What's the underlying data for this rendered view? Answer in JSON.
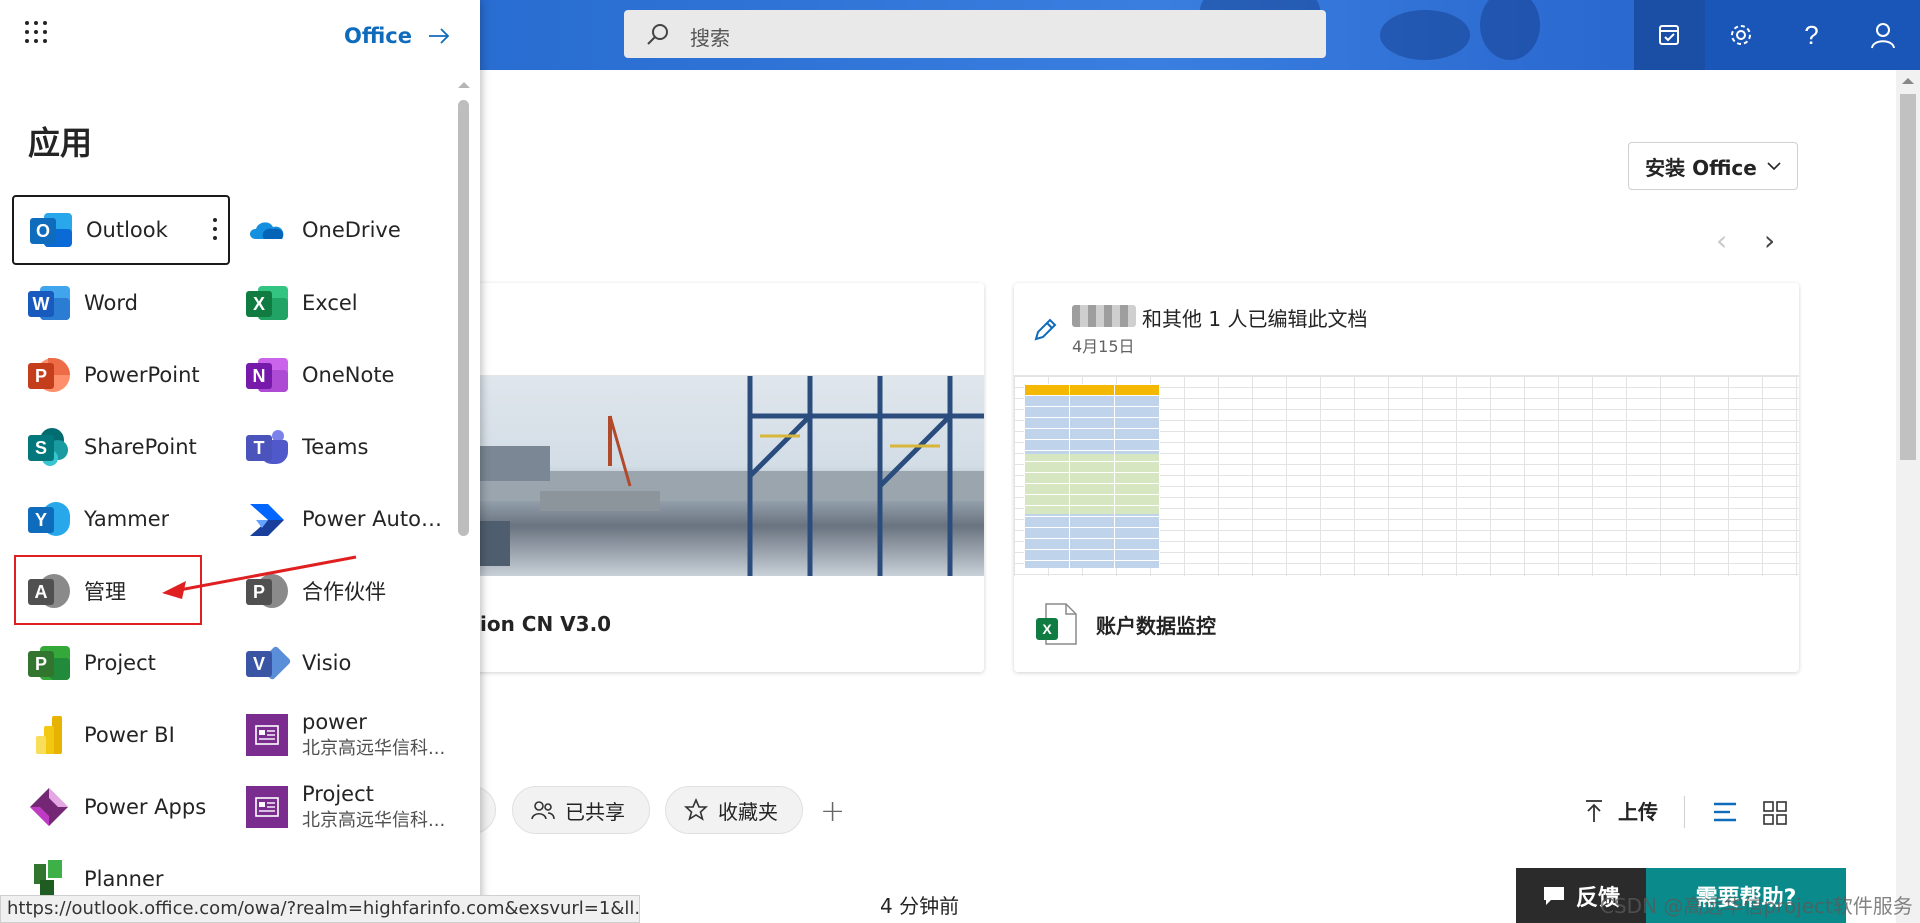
{
  "topbar": {
    "search_placeholder": "搜索",
    "icons": [
      "my-day-icon",
      "settings-icon",
      "help-icon",
      "account-icon"
    ],
    "help_glyph": "?"
  },
  "launcher": {
    "office_link": "Office",
    "section_title": "应用",
    "apps": [
      {
        "label": "Outlook",
        "icon": "outlook-icon",
        "color": "#0f6cbd"
      },
      {
        "label": "OneDrive",
        "icon": "onedrive-icon",
        "color": "#1490df"
      },
      {
        "label": "Word",
        "icon": "word-icon",
        "color": "#185abd"
      },
      {
        "label": "Excel",
        "icon": "excel-icon",
        "color": "#107c41"
      },
      {
        "label": "PowerPoint",
        "icon": "powerpoint-icon",
        "color": "#c43e1c"
      },
      {
        "label": "OneNote",
        "icon": "onenote-icon",
        "color": "#7719aa"
      },
      {
        "label": "SharePoint",
        "icon": "sharepoint-icon",
        "color": "#036c70"
      },
      {
        "label": "Teams",
        "icon": "teams-icon",
        "color": "#4b53bc"
      },
      {
        "label": "Yammer",
        "icon": "yammer-icon",
        "color": "#106ebe"
      },
      {
        "label": "Power Autom...",
        "icon": "power-automate-icon",
        "color": "#0066ff"
      },
      {
        "label": "管理",
        "icon": "admin-icon",
        "color": "#505050"
      },
      {
        "label": "合作伙伴",
        "icon": "partner-icon",
        "color": "#505050"
      },
      {
        "label": "Project",
        "icon": "project-icon",
        "color": "#31752f"
      },
      {
        "label": "Visio",
        "icon": "visio-icon",
        "color": "#3955a3"
      },
      {
        "label": "Power BI",
        "icon": "power-bi-icon",
        "color": "#f2c811"
      },
      {
        "label": "power",
        "sublabel": "北京高远华信科...",
        "icon": "custom-app-icon",
        "color": "#7b2c8f"
      },
      {
        "label": "Power Apps",
        "icon": "power-apps-icon",
        "color": "#742774"
      },
      {
        "label": "Project",
        "sublabel": "北京高远华信科...",
        "icon": "custom-app-icon",
        "color": "#7b2c8f"
      },
      {
        "label": "Planner",
        "icon": "planner-icon",
        "color": "#31752f"
      }
    ]
  },
  "main": {
    "install_button": "安装 Office",
    "cards": [
      {
        "title": "ion CN V3.0"
      },
      {
        "edited_by": "和其他 1 人已编辑此文档",
        "date": "4月15日",
        "title": "账户数据监控",
        "file_badge": "X"
      }
    ],
    "filters": {
      "shared": "已共享",
      "favorites": "收藏夹"
    },
    "upload": "上传",
    "recent_time": "4 分钟前"
  },
  "footer": {
    "feedback": "反馈",
    "help": "需要帮助?",
    "watermark": "CSDN @高远华信project软件服务",
    "status_url": "https://outlook.office.com/owa/?realm=highfarinfo.com&exsvurl=1&ll..."
  },
  "colors": {
    "topbar": "#2f73d6",
    "link": "#0f6cbd",
    "annotation": "#e02020",
    "help_button": "#0a8a8a"
  }
}
